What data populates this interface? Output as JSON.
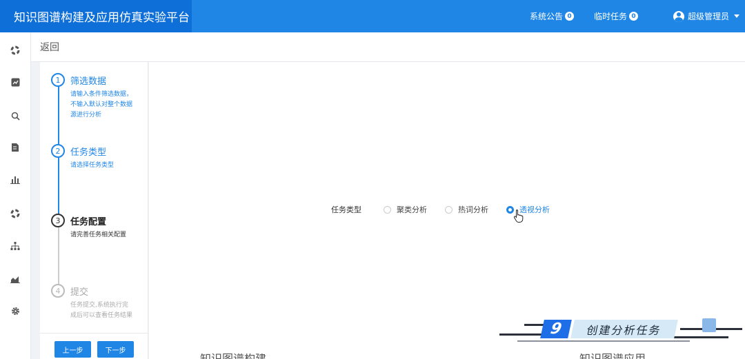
{
  "header": {
    "app_title": "知识图谱构建及应用仿真实验平台",
    "announce_label": "系统公告",
    "announce_count": "0",
    "temp_task_label": "临时任务",
    "temp_task_count": "0",
    "user_name": "超级管理员"
  },
  "sidebar": {
    "icons": [
      "dashboard-icon",
      "chart-icon",
      "search-icon",
      "document-icon",
      "bar-chart-icon",
      "dashboard-icon",
      "hierarchy-icon",
      "trend-icon",
      "gear-icon"
    ]
  },
  "back_label": "返回",
  "steps": [
    {
      "num": "1",
      "title": "筛选数据",
      "desc": "请输入条件筛选数据，不输入默认对整个数据源进行分析"
    },
    {
      "num": "2",
      "title": "任务类型",
      "desc": "请选择任务类型"
    },
    {
      "num": "3",
      "title": "任务配置",
      "desc": "请完善任务相关配置"
    },
    {
      "num": "4",
      "title": "提交",
      "desc": "任务提交,系统执行完成后可以查看任务结果"
    }
  ],
  "buttons": {
    "prev": "上一步",
    "next": "下一步"
  },
  "form": {
    "label": "任务类型",
    "options": [
      "聚类分析",
      "热词分析",
      "透视分析"
    ],
    "selected": "透视分析"
  },
  "caption": {
    "number": "9",
    "text": "创建分析任务"
  },
  "bottom_text": {
    "left": "知识图谱构建",
    "right": "知识图谱应用"
  },
  "colors": {
    "accent": "#1f86e6",
    "header_dark": "#0f6fd8"
  }
}
